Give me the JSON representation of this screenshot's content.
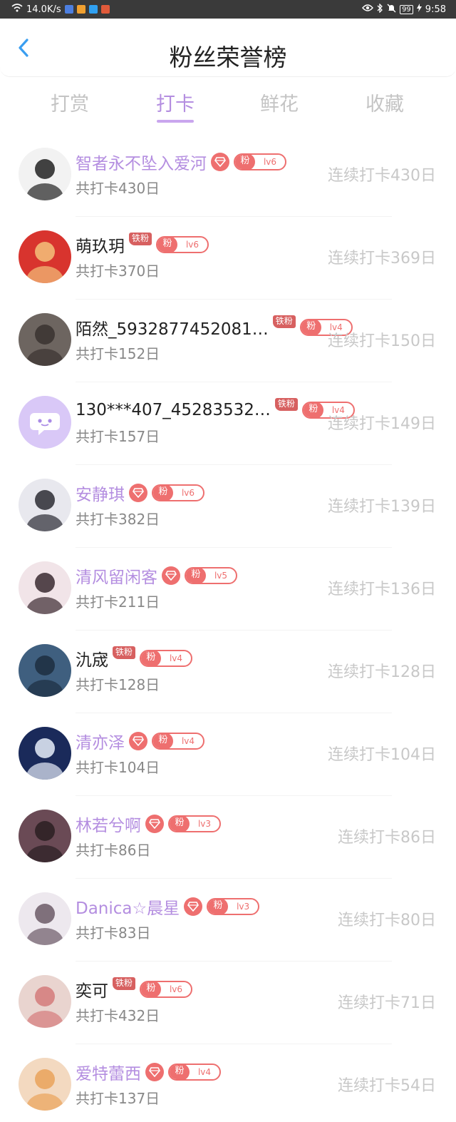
{
  "status_bar": {
    "net_speed": "14.0K/s",
    "battery": "99",
    "time": "9:58"
  },
  "header": {
    "title": "粉丝荣誉榜"
  },
  "tabs": [
    {
      "label": "打赏",
      "active": false
    },
    {
      "label": "打卡",
      "active": true
    },
    {
      "label": "鲜花",
      "active": false
    },
    {
      "label": "收藏",
      "active": false
    }
  ],
  "badges": {
    "fan_label": "粉",
    "iron_label": "铁粉"
  },
  "rows": [
    {
      "name": "智者永不坠入爱河",
      "vip": true,
      "badge_type": "gem",
      "level": "lv6",
      "total": "共打卡430日",
      "streak": "连续打卡430日"
    },
    {
      "name": "萌玖玥",
      "vip": false,
      "badge_type": "iron",
      "level": "lv6",
      "total": "共打卡370日",
      "streak": "连续打卡369日"
    },
    {
      "name": "陌然_5932877452081…",
      "vip": false,
      "badge_type": "iron",
      "level": "lv4",
      "total": "共打卡152日",
      "streak": "连续打卡150日"
    },
    {
      "name": "130***407_45283532…",
      "vip": false,
      "badge_type": "iron",
      "level": "lv4",
      "total": "共打卡157日",
      "streak": "连续打卡149日"
    },
    {
      "name": "安静琪",
      "vip": true,
      "badge_type": "gem",
      "level": "lv6",
      "total": "共打卡382日",
      "streak": "连续打卡139日"
    },
    {
      "name": "清风留闲客",
      "vip": true,
      "badge_type": "gem",
      "level": "lv5",
      "total": "共打卡211日",
      "streak": "连续打卡136日"
    },
    {
      "name": "氿宬",
      "vip": false,
      "badge_type": "iron",
      "level": "lv4",
      "total": "共打卡128日",
      "streak": "连续打卡128日"
    },
    {
      "name": "清亦泽",
      "vip": true,
      "badge_type": "gem",
      "level": "lv4",
      "total": "共打卡104日",
      "streak": "连续打卡104日"
    },
    {
      "name": "林若兮啊",
      "vip": true,
      "badge_type": "gem",
      "level": "lv3",
      "total": "共打卡86日",
      "streak": "连续打卡86日"
    },
    {
      "name": "Danica☆晨星",
      "vip": true,
      "badge_type": "gem",
      "level": "lv3",
      "total": "共打卡83日",
      "streak": "连续打卡80日"
    },
    {
      "name": "奕可",
      "vip": false,
      "badge_type": "iron",
      "level": "lv6",
      "total": "共打卡432日",
      "streak": "连续打卡71日"
    },
    {
      "name": "爱特蕾西",
      "vip": true,
      "badge_type": "gem",
      "level": "lv4",
      "total": "共打卡137日",
      "streak": "连续打卡54日"
    }
  ],
  "colors": {
    "accent": "#b48ee0",
    "badge": "#ee6f6f",
    "muted": "#c8c8c8"
  }
}
